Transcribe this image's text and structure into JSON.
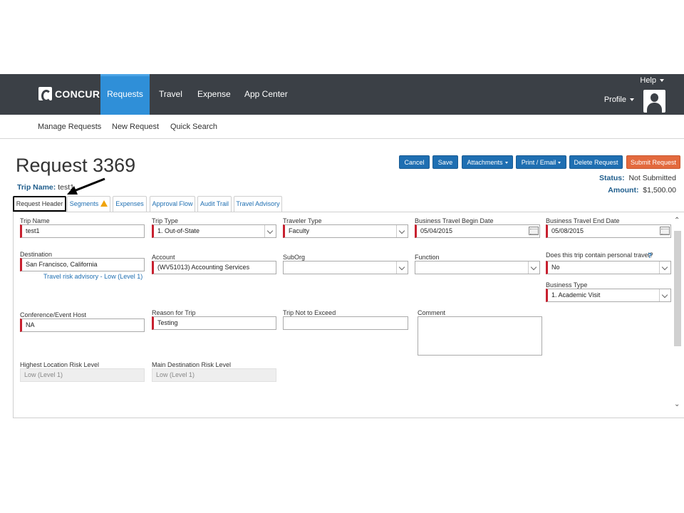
{
  "nav": {
    "logo_text": "CONCUR",
    "items": [
      "Requests",
      "Travel",
      "Expense",
      "App Center"
    ],
    "help": "Help",
    "profile": "Profile"
  },
  "subnav": [
    "Manage Requests",
    "New Request",
    "Quick Search"
  ],
  "request": {
    "title": "Request 3369",
    "trip_name_label": "Trip Name:",
    "trip_name_value": "test1",
    "status_label": "Status:",
    "status_value": "Not Submitted",
    "amount_label": "Amount:",
    "amount_value": "$1,500.00"
  },
  "buttons": {
    "cancel": "Cancel",
    "save": "Save",
    "attachments": "Attachments",
    "print_email": "Print / Email",
    "delete": "Delete Request",
    "submit": "Submit Request"
  },
  "tabs": [
    "Request Header",
    "Segments",
    "Expenses",
    "Approval Flow",
    "Audit Trail",
    "Travel Advisory"
  ],
  "form": {
    "trip_name": {
      "label": "Trip Name",
      "value": "test1"
    },
    "trip_type": {
      "label": "Trip Type",
      "value": "1. Out-of-State"
    },
    "traveler_type": {
      "label": "Traveler Type",
      "value": "Faculty"
    },
    "begin_date": {
      "label": "Business Travel Begin Date",
      "value": "05/04/2015"
    },
    "end_date": {
      "label": "Business Travel End Date",
      "value": "05/08/2015"
    },
    "destination": {
      "label": "Destination",
      "value": "San Francisco, California",
      "link": "Travel risk advisory - Low (Level 1)"
    },
    "account": {
      "label": "Account",
      "value": "(WV51013) Accounting Services"
    },
    "suborg": {
      "label": "SubOrg",
      "value": ""
    },
    "function": {
      "label": "Function",
      "value": ""
    },
    "personal_travel": {
      "label": "Does this trip contain personal travel?",
      "value": "No",
      "help": "?"
    },
    "business_type": {
      "label": "Business Type",
      "value": "1. Academic Visit"
    },
    "conference_host": {
      "label": "Conference/Event Host",
      "value": "NA"
    },
    "reason": {
      "label": "Reason for Trip",
      "value": "Testing"
    },
    "not_to_exceed": {
      "label": "Trip Not to Exceed",
      "value": ""
    },
    "comment": {
      "label": "Comment",
      "value": ""
    },
    "highest_risk": {
      "label": "Highest Location Risk Level",
      "value": "Low (Level 1)"
    },
    "main_risk": {
      "label": "Main Destination Risk Level",
      "value": "Low (Level 1)"
    }
  },
  "colors": {
    "nav_bg": "#3b4046",
    "nav_active": "#2f8fd8",
    "button_blue": "#1f6fb2",
    "button_red": "#e36a3e",
    "required_marker": "#c8202f",
    "warning": "#f0a30a"
  }
}
